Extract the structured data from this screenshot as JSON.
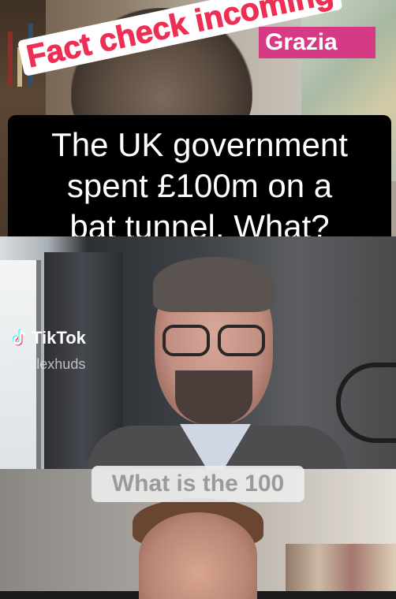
{
  "overlay": {
    "banner_text": "Fact check incoming",
    "caption_lines": [
      "The UK government",
      "spent £100m on a",
      "bat tunnel. What?"
    ],
    "subtitle_text": "What is the 100"
  },
  "watermark": {
    "brand": "TikTok",
    "username": "@alexhuds"
  },
  "colors": {
    "banner_text": "#ee2f55",
    "caption_bg": "#000000",
    "subtitle_bg": "#ececec"
  }
}
